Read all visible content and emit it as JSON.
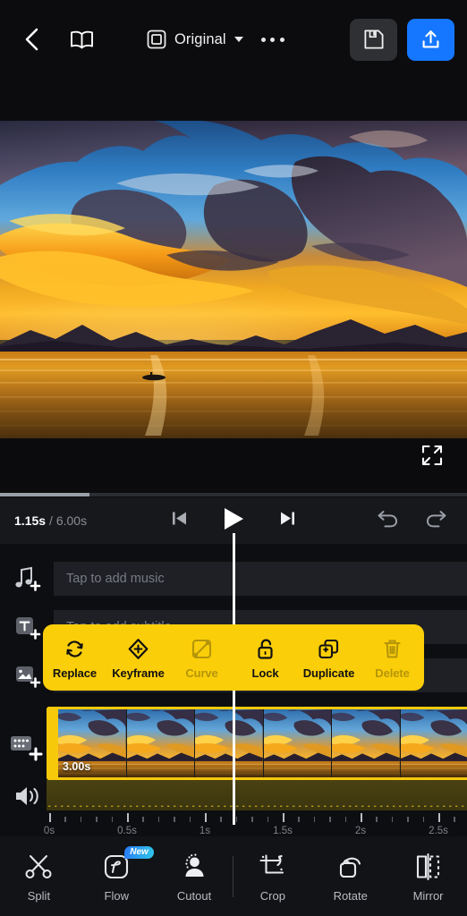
{
  "header": {
    "back_icon": "chevron-left-icon",
    "tutorial_icon": "book-icon",
    "ratio_icon": "aspect-ratio-icon",
    "ratio_label": "Original",
    "more_icon": "more-dots-icon",
    "save_icon": "floppy-save-icon",
    "export_icon": "upload-export-icon",
    "export_color": "#1577ff"
  },
  "preview": {
    "fullscreen_icon": "fullscreen-expand-icon",
    "scene": "sunset over lake with mountains"
  },
  "player": {
    "current_time": "1.15s",
    "separator": "/",
    "total_time": "6.00s",
    "progress_percent": 19.2,
    "prev_frame_icon": "skip-previous-icon",
    "play_icon": "play-icon",
    "next_frame_icon": "skip-next-icon",
    "undo_icon": "undo-icon",
    "redo_icon": "redo-icon"
  },
  "timeline": {
    "music_row": {
      "icon": "add-music-icon",
      "label": "Tap to add music"
    },
    "subtitle_row": {
      "icon": "add-subtitle-icon",
      "label": "Tap to add subtitle"
    },
    "overlay_row": {
      "icon": "add-overlay-icon",
      "label": ""
    },
    "clip": {
      "icon": "add-clip-icon",
      "duration": "3.00s",
      "thumbnail_count": 6,
      "selected": true,
      "border_color": "#f6c90b"
    },
    "audio": {
      "icon": "speaker-volume-icon"
    },
    "ruler_labels": [
      "0s",
      "0.5s",
      "1s",
      "1.5s",
      "2s",
      "2.5s"
    ],
    "playhead_time": "1.15s"
  },
  "context_menu": {
    "background_color": "#fbce0a",
    "items": [
      {
        "label": "Replace",
        "icon": "replace-icon",
        "disabled": false
      },
      {
        "label": "Keyframe",
        "icon": "keyframe-icon",
        "disabled": false
      },
      {
        "label": "Curve",
        "icon": "curve-icon",
        "disabled": true
      },
      {
        "label": "Lock",
        "icon": "unlock-icon",
        "disabled": false
      },
      {
        "label": "Duplicate",
        "icon": "duplicate-icon",
        "disabled": false
      },
      {
        "label": "Delete",
        "icon": "trash-icon",
        "disabled": true
      }
    ]
  },
  "bottom_toolbar": {
    "items": [
      {
        "label": "Split",
        "icon": "scissors-icon",
        "badge": ""
      },
      {
        "label": "Flow",
        "icon": "flow-icon",
        "badge": "New"
      },
      {
        "label": "Cutout",
        "icon": "person-cutout-icon",
        "badge": ""
      },
      {
        "label": "Crop",
        "icon": "crop-icon",
        "badge": ""
      },
      {
        "label": "Rotate",
        "icon": "rotate-icon",
        "badge": ""
      },
      {
        "label": "Mirror",
        "icon": "mirror-icon",
        "badge": ""
      }
    ]
  }
}
